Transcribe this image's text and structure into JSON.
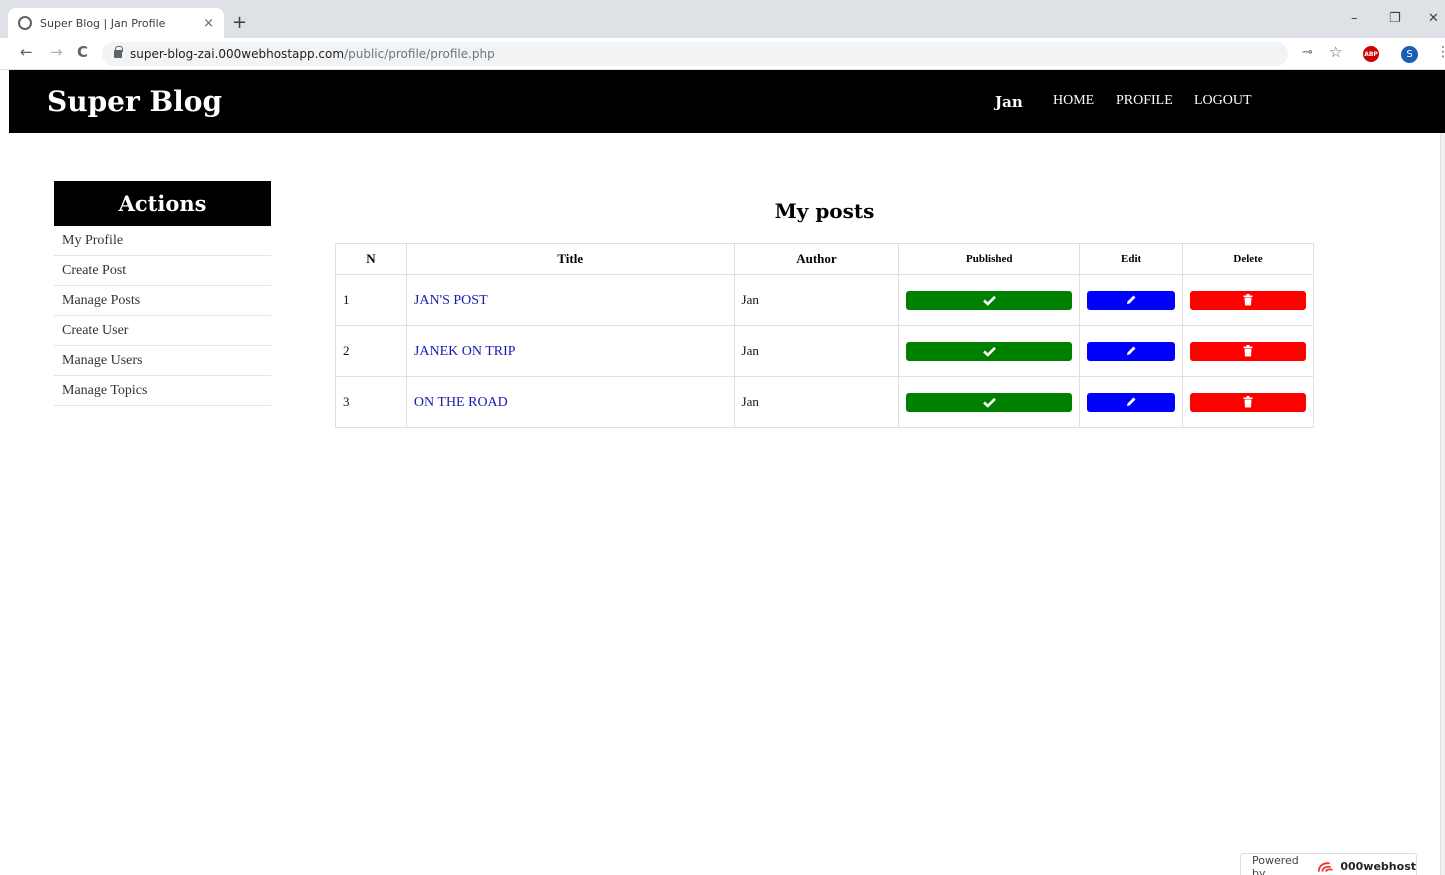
{
  "browser": {
    "tab_title": "Super Blog | Jan Profile",
    "tab_close": "×",
    "new_tab": "+",
    "minimize": "–",
    "restore": "❐",
    "close": "✕",
    "back": "←",
    "forward": "→",
    "reload": "C",
    "url_host": "super-blog-zai.000webhostapp.com",
    "url_path": "/public/profile/profile.php",
    "key_icon": "⊸",
    "star_icon": "☆",
    "abp_label": "ABP",
    "profile_initial": "S",
    "menu_icon": "⋮"
  },
  "header": {
    "logo": "Super Blog",
    "user": "Jan",
    "nav": [
      "HOME",
      "PROFILE",
      "LOGOUT"
    ]
  },
  "sidebar": {
    "title": "Actions",
    "items": [
      "My Profile",
      "Create Post",
      "Manage Posts",
      "Create User",
      "Manage Users",
      "Manage Topics"
    ]
  },
  "main": {
    "title": "My posts",
    "columns": [
      "N",
      "Title",
      "Author",
      "Published",
      "Edit",
      "Delete"
    ],
    "rows": [
      {
        "n": "1",
        "title": "JAN'S POST",
        "author": "Jan"
      },
      {
        "n": "2",
        "title": "JANEK ON TRIP",
        "author": "Jan"
      },
      {
        "n": "3",
        "title": "ON THE ROAD",
        "author": "Jan"
      }
    ],
    "colors": {
      "published": "#008000",
      "edit": "#0000ff",
      "delete": "#ff0000"
    }
  },
  "footer": {
    "powered_by": "Powered by",
    "brand": "000webhost"
  }
}
